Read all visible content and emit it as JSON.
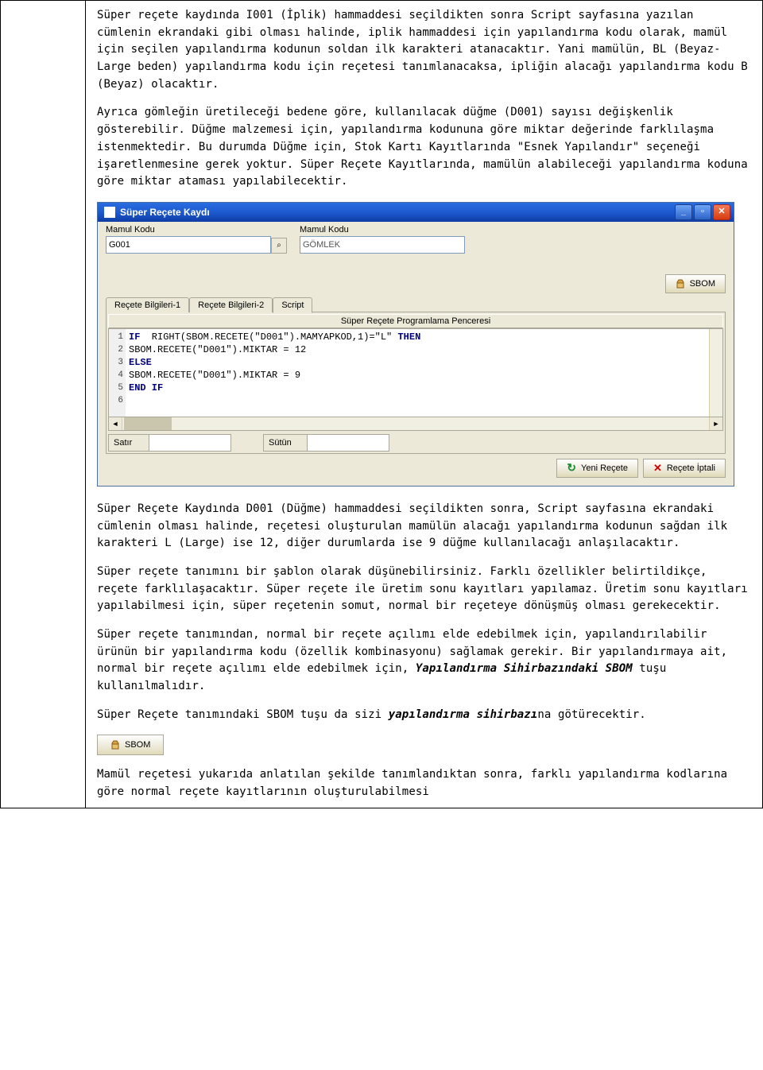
{
  "para1": "Süper reçete kaydında I001 (İplik) hammaddesi seçildikten sonra Script sayfasına yazılan cümlenin ekrandaki gibi olması halinde, iplik hammaddesi için yapılandırma kodu olarak, mamül için seçilen yapılandırma kodunun soldan ilk karakteri atanacaktır. Yani mamülün, BL (Beyaz-Large beden) yapılandırma kodu için reçetesi tanımlanacaksa, ipliğin alacağı yapılandırma kodu B (Beyaz) olacaktır.",
  "para2": "Ayrıca gömleğin üretileceği bedene göre, kullanılacak düğme (D001) sayısı değişkenlik gösterebilir. Düğme malzemesi için, yapılandırma kodununa göre miktar değerinde farklılaşma istenmektedir. Bu durumda Düğme için, Stok Kartı Kayıtlarında \"Esnek Yapılandır\" seçeneği işaretlenmesine gerek yoktur. Süper Reçete Kayıtlarında, mamülün alabileceği yapılandırma koduna göre miktar ataması yapılabilecektir.",
  "dialog": {
    "title": "Süper Reçete Kaydı",
    "field1_label": "Mamul Kodu",
    "field1_value": "G001",
    "field2_label": "Mamul Kodu",
    "field2_value": "GÖMLEK",
    "sbom_label": "SBOM",
    "tab1": "Reçete Bilgileri-1",
    "tab2": "Reçete Bilgileri-2",
    "tab3": "Script",
    "panel_caption": "Süper Reçete Programlama Penceresi",
    "code": {
      "l1_kw1": "IF",
      "l1_body": "  RIGHT(SBOM.RECETE(\"D001\").MAMYAPKOD,1)=\"L\" ",
      "l1_kw2": "THEN",
      "l2": "SBOM.RECETE(\"D001\").MIKTAR = 12",
      "l3": "ELSE",
      "l4": "SBOM.RECETE(\"D001\").MIKTAR = 9",
      "l5": "END IF",
      "g1": "1",
      "g2": "2",
      "g3": "3",
      "g4": "4",
      "g5": "5",
      "g6": "6"
    },
    "status_satir": "Satır",
    "status_sutun": "Sütün",
    "btn_yeni": "Yeni Reçete",
    "btn_iptal": "Reçete İptali"
  },
  "para3": "Süper Reçete Kaydında D001 (Düğme) hammaddesi seçildikten sonra, Script sayfasına ekrandaki cümlenin olması halinde, reçetesi oluşturulan mamülün alacağı yapılandırma kodunun sağdan ilk karakteri L (Large) ise 12, diğer durumlarda ise 9 düğme kullanılacağı anlaşılacaktır.",
  "para4": "Süper reçete tanımını bir şablon olarak düşünebilirsiniz. Farklı özellikler belirtildikçe, reçete farklılaşacaktır. Süper reçete ile üretim sonu kayıtları yapılamaz. Üretim sonu kayıtları yapılabilmesi için, süper reçetenin somut, normal bir reçeteye dönüşmüş olması gerekecektir.",
  "para5_a": "Süper reçete tanımından, normal bir reçete açılımı elde edebilmek için, yapılandırılabilir ürünün bir yapılandırma kodu (özellik kombinasyonu) sağlamak gerekir. Bir yapılandırmaya ait, normal bir reçete açılımı elde edebilmek için, ",
  "para5_b": "Yapılandırma Sihirbazındaki SBOM",
  "para5_c": " tuşu kullanılmalıdır.",
  "para6_a": "Süper Reçete tanımındaki SBOM tuşu da sizi ",
  "para6_b": "yapılandırma sihirbazı",
  "para6_c": "na götürecektir.",
  "sbom_standalone": "SBOM",
  "para7": "Mamül reçetesi yukarıda anlatılan şekilde tanımlandıktan sonra, farklı yapılandırma kodlarına göre normal reçete kayıtlarının oluşturulabilmesi"
}
